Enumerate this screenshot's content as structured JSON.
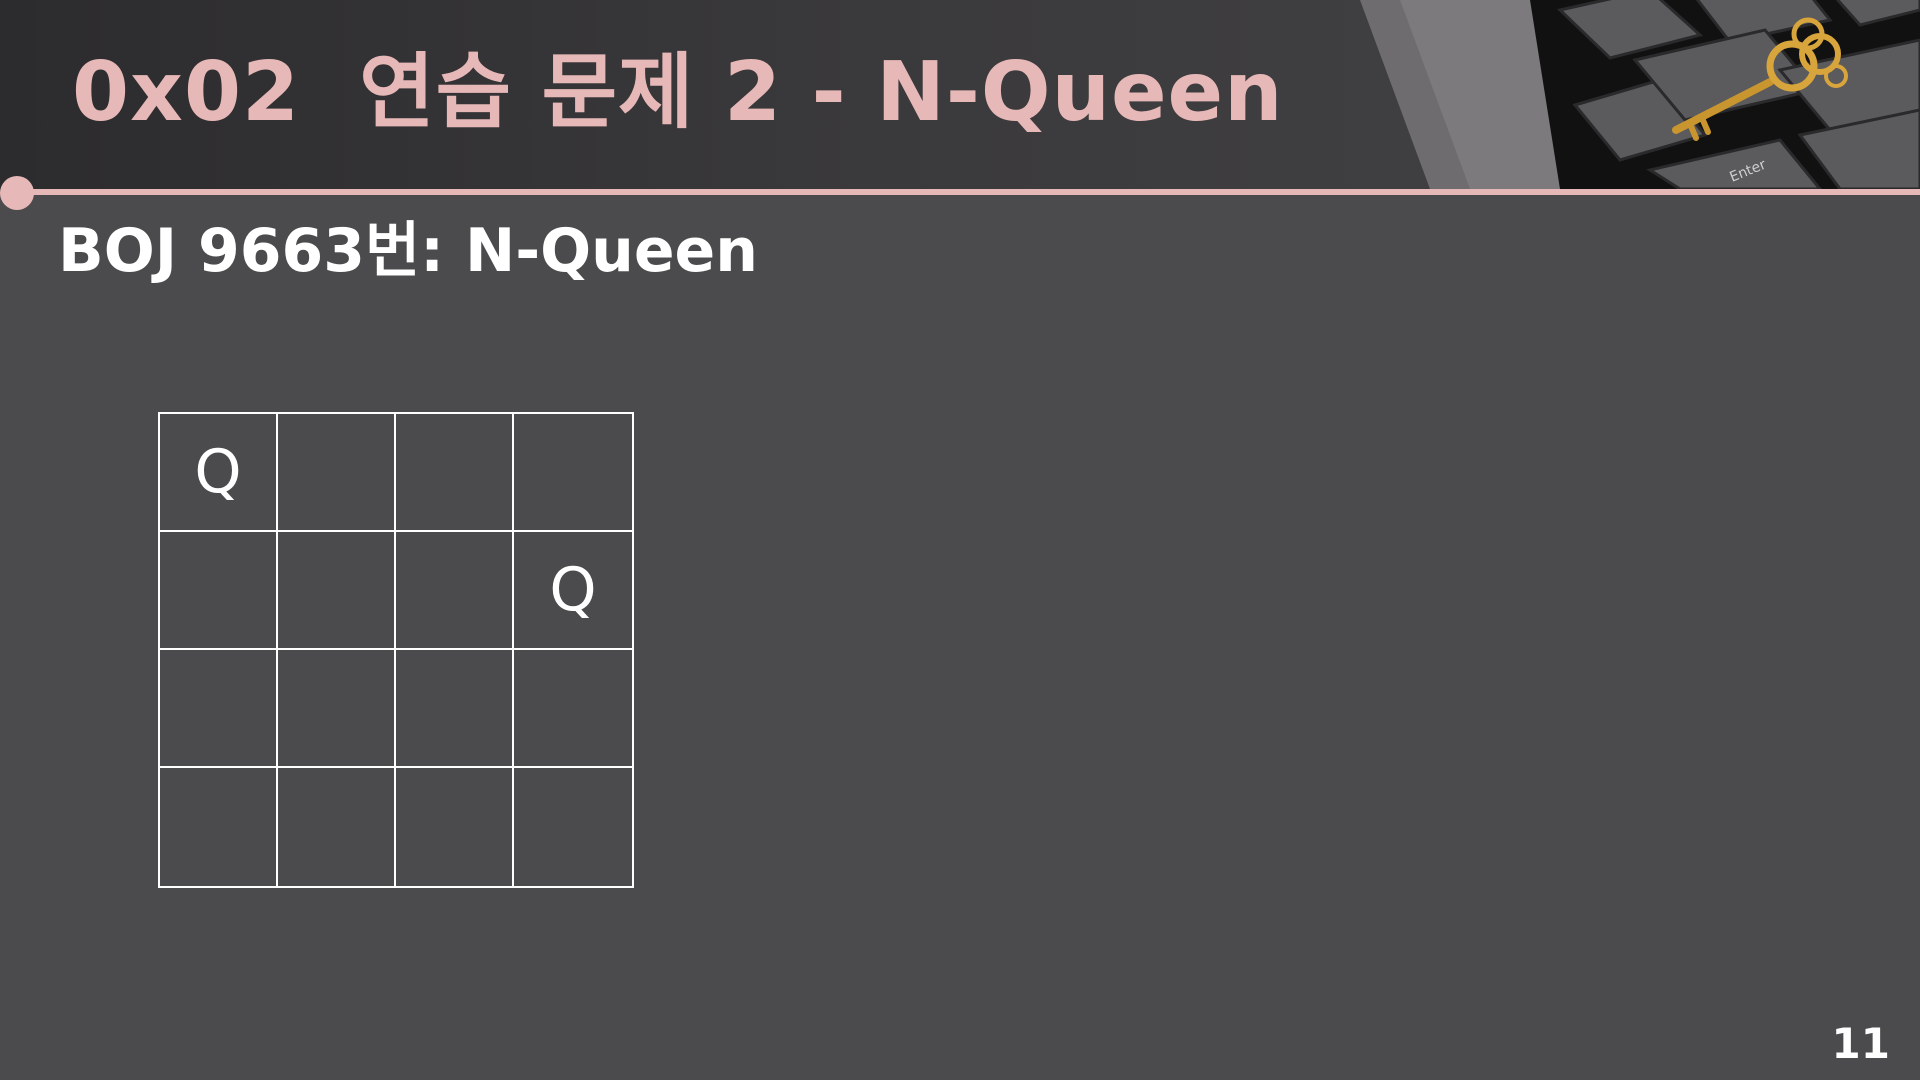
{
  "slide": {
    "title": "0x02  연습 문제 2 - N-Queen",
    "subtitle": "BOJ 9663번: N-Queen",
    "page_number": "11"
  },
  "board": {
    "size": 4,
    "queen_symbol": "Q",
    "queens": [
      {
        "row": 0,
        "col": 0
      },
      {
        "row": 1,
        "col": 3
      }
    ]
  },
  "decoration": {
    "image": "keyboard-with-golden-key",
    "key_label": "Enter"
  },
  "colors": {
    "accent": "#e6b8b7",
    "background": "#4b4a4c",
    "text": "#ffffff"
  }
}
